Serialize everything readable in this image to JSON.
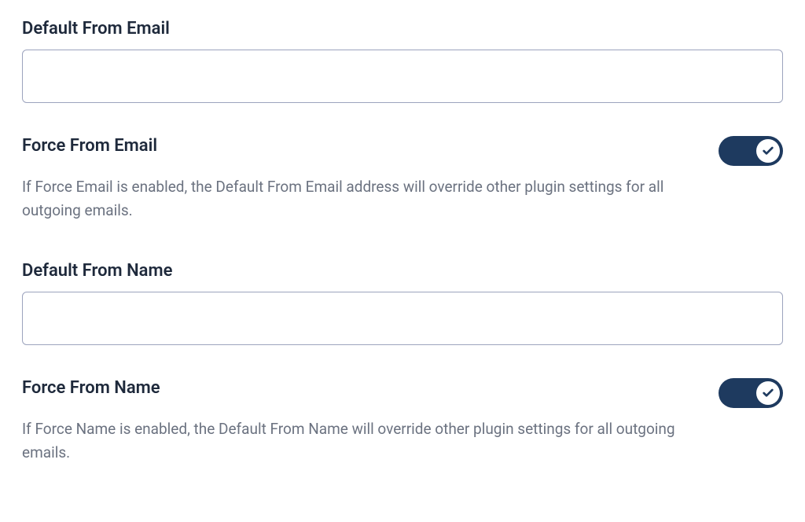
{
  "fields": {
    "default_from_email": {
      "label": "Default From Email",
      "value": ""
    },
    "force_from_email": {
      "label": "Force From Email",
      "enabled": true,
      "description": "If Force Email is enabled, the Default From Email address will override other plugin settings for all outgoing emails."
    },
    "default_from_name": {
      "label": "Default From Name",
      "value": ""
    },
    "force_from_name": {
      "label": "Force From Name",
      "enabled": true,
      "description": "If Force Name is enabled, the Default From Name will override other plugin settings for all outgoing emails."
    }
  },
  "colors": {
    "toggle_active": "#1e3a5f",
    "text_primary": "#1e293b",
    "text_secondary": "#6b7280",
    "border": "#9ca3bd"
  }
}
